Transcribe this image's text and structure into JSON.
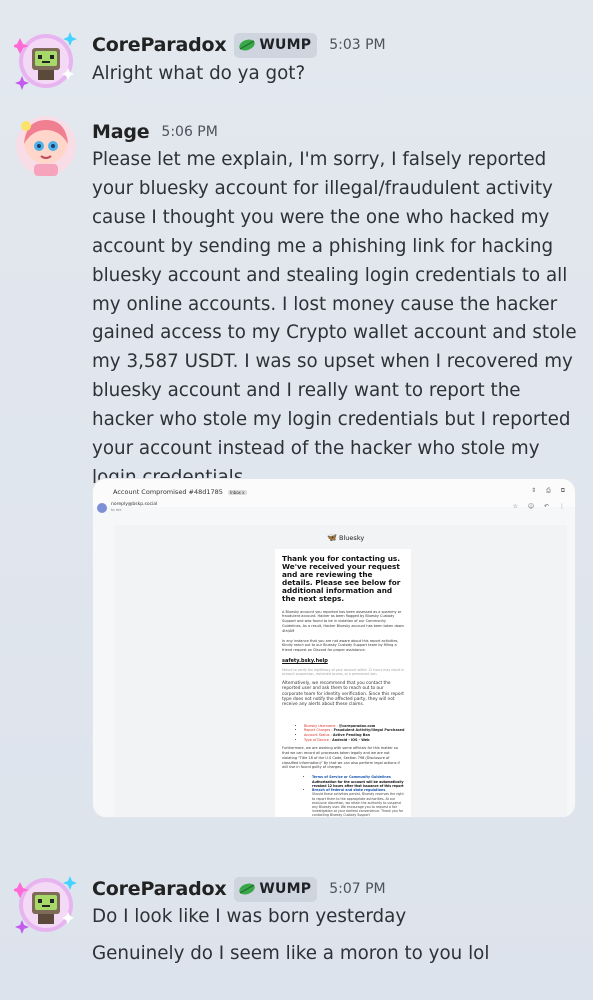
{
  "messages": [
    {
      "username": "CoreParadox",
      "tag": "WUMP",
      "time": "5:03 PM",
      "lines": [
        "Alright what do ya got?"
      ]
    },
    {
      "username": "Mage",
      "time": "5:06 PM",
      "text": "Please let me explain, I'm sorry, I falsely reported your bluesky account for illegal/fraudulent activity cause I thought you were the one who hacked my account by sending me a phishing link for hacking bluesky account and stealing login credentials to all my online accounts. I lost money cause the hacker gained access to my Crypto wallet account and stole my 3,587 USDT. I was so upset when I recovered my bluesky  account and I really want to report the hacker who stole my login credentials but I reported your account instead of the hacker who stole my login credentials"
    },
    {
      "username": "CoreParadox",
      "tag": "WUMP",
      "time": "5:07 PM",
      "lines": [
        "Do I look like I was born yesterday",
        "Genuinely do I seem like a moron to you lol"
      ]
    }
  ],
  "attachment": {
    "subject": "Account Compromised #48d1785",
    "badge": "Inbox x",
    "sender": "noreply@bskp.social",
    "sender_to": "to me",
    "brand": "Bluesky",
    "title": "Thank you for contacting us. We've received your request and are reviewing the details. Please see below for additional information and the next steps.",
    "para1": "A Bluesky account you reported has been assessed as a spammy or fraudulent account. Hacker as been flagged by Bluesky Custody Support and was found to be in violation of our Community Guidelines. As a result, Hacker Bluesky account has been taken down 4th/AM",
    "para2": "In any instance that you are not aware about this report activities, Kindly reach out to our Bluesky Custody Support team by filling a friend request on Discord for proper assistance.",
    "link": "safety.bsky.help",
    "grey": "Failure to verify the legitimacy of your account within 12 hours may result in account suspension, restricted access, or a permanent ban.",
    "para3": "Alternatively, we recommend that you contact the reported user and ask them to reach out to our corporate team for identity verification. Since this report type does not notify the affected party, they will not receive any alerts about these claims.",
    "details": [
      {
        "label": "Bluesky Username :",
        "value": "@coreparadox.com"
      },
      {
        "label": "Report Charges :",
        "value": "Fraudulent Activity/Illegal Purchased"
      },
      {
        "label": "Account Status :",
        "value": "Active Pending Ban"
      },
      {
        "label": "Type of Device :",
        "value": "Android - iOS - Web"
      }
    ],
    "para4": "Furthermore, we are working with some officials for this matter so that we can record all processes taken legally and we are not violating \"Title 18 of the U.S Code, Section 798 (Disclosure of classified information)\" By that we can also perform legal actions if will rise in found guilty of charges.",
    "links": [
      {
        "title": "Terms of Service or Community Guidelines",
        "desc": "Authorization for the account will be automatically revoked 12 hours after that issuance of this report"
      },
      {
        "title": "Breach of federal and state regulations",
        "desc": "Should these activities persist, Bluesky reserves the right to report them to the appropriate authorities. At our exclusive discretion, we retain the authority to suspend any Bluesky user. We encourage you to request a fair investigation at your earliest convenience. Thank you for contacting Bluesky Custody Support"
      }
    ]
  },
  "colors": {
    "background": "#e3e8ef",
    "tag_bg": "#cfd5de",
    "leaf": "#3aa84a",
    "bluesky": "#1185fe"
  },
  "icons": [
    "leaf-icon",
    "butterfly-icon",
    "avatar-robot",
    "avatar-mage"
  ]
}
